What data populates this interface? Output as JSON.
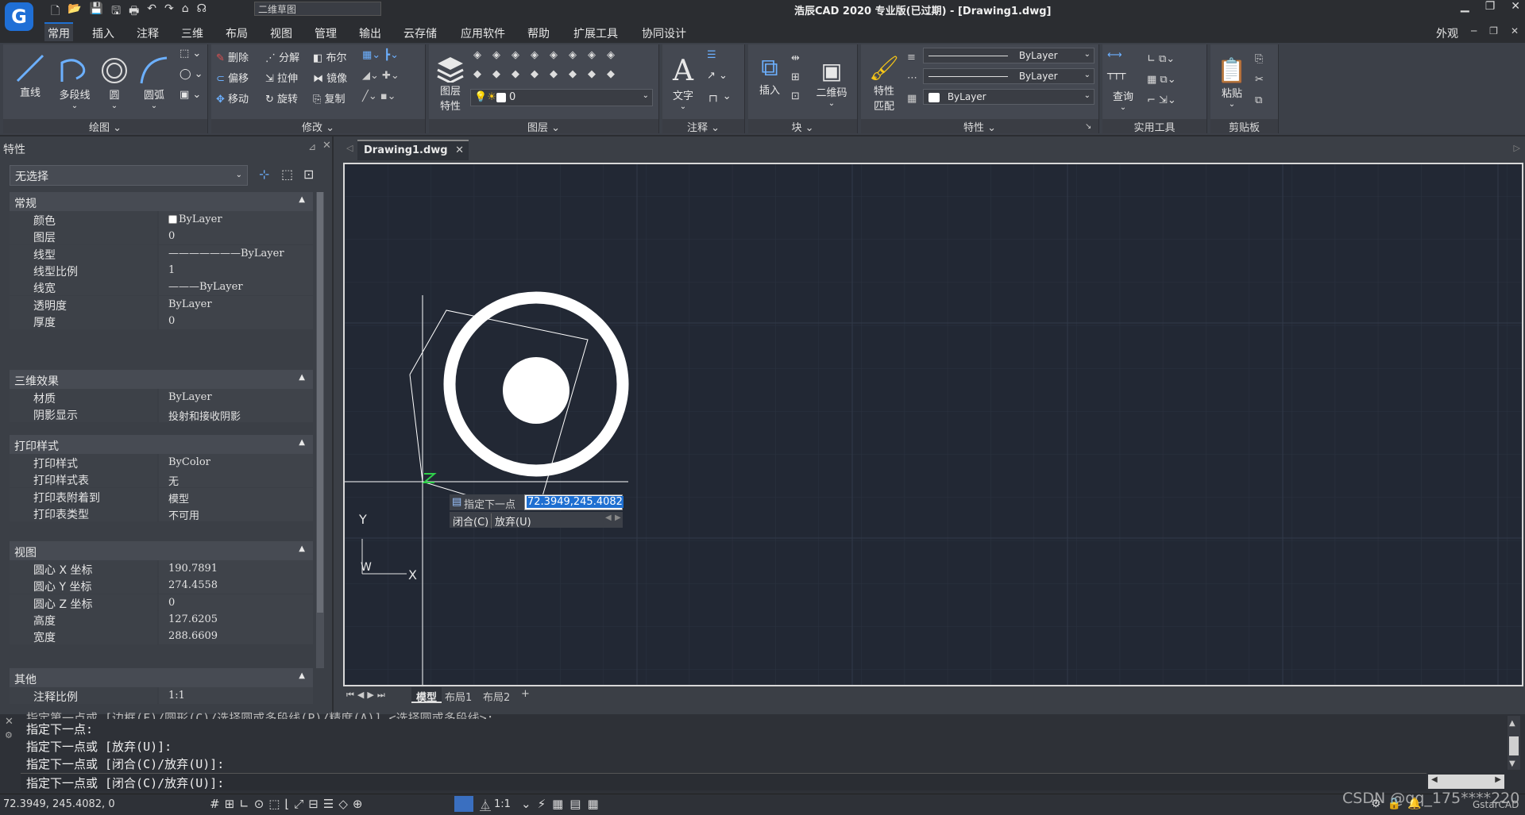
{
  "titlebar": {
    "title": "浩辰CAD 2020 专业版(已过期) - [Drawing1.dwg]",
    "workspace": "二维草图"
  },
  "menu": {
    "items": [
      "常用",
      "插入",
      "注释",
      "三维",
      "布局",
      "视图",
      "管理",
      "输出",
      "云存储",
      "应用软件",
      "帮助",
      "扩展工具",
      "协同设计"
    ],
    "right": "外观"
  },
  "ribbon": {
    "draw": {
      "label": "绘图",
      "line": "直线",
      "polyline": "多段线",
      "circle": "圆",
      "arc": "圆弧"
    },
    "modify": {
      "label": "修改",
      "erase": "删除",
      "explode": "分解",
      "boolean": "布尔",
      "offset": "偏移",
      "stretch": "拉伸",
      "mirror": "镜像",
      "move": "移动",
      "rotate": "旋转",
      "copy": "复制"
    },
    "layer": {
      "label": "图层",
      "props_l1": "图层",
      "props_l2": "特性",
      "current": "0"
    },
    "annotation": {
      "label": "注释",
      "text": "文字"
    },
    "block": {
      "label": "块",
      "insert": "插入",
      "qrcode": "二维码"
    },
    "properties": {
      "label": "特性",
      "match_l1": "特性",
      "match_l2": "匹配",
      "linetype": "ByLayer",
      "lineweight": "ByLayer",
      "color": "ByLayer"
    },
    "utilities": {
      "label": "实用工具",
      "query": "查询"
    },
    "clipboard": {
      "label": "剪贴板",
      "paste": "粘贴"
    }
  },
  "props_panel": {
    "title": "特性",
    "selection": "无选择",
    "groups": {
      "general": "常规",
      "3d": "三维效果",
      "plot": "打印样式",
      "view": "视图",
      "misc": "其他"
    },
    "general_rows": [
      {
        "k": "颜色",
        "v": "ByLayer"
      },
      {
        "k": "图层",
        "v": "0"
      },
      {
        "k": "线型",
        "v": "———————ByLayer"
      },
      {
        "k": "线型比例",
        "v": "1"
      },
      {
        "k": "线宽",
        "v": "———ByLayer"
      },
      {
        "k": "透明度",
        "v": "ByLayer"
      },
      {
        "k": "厚度",
        "v": "0"
      }
    ],
    "3d_rows": [
      {
        "k": "材质",
        "v": "ByLayer"
      },
      {
        "k": "阴影显示",
        "v": "投射和接收阴影"
      }
    ],
    "plot_rows": [
      {
        "k": "打印样式",
        "v": "ByColor"
      },
      {
        "k": "打印样式表",
        "v": "无"
      },
      {
        "k": "打印表附着到",
        "v": "模型"
      },
      {
        "k": "打印表类型",
        "v": "不可用"
      }
    ],
    "view_rows": [
      {
        "k": "圆心 X 坐标",
        "v": "190.7891"
      },
      {
        "k": "圆心 Y 坐标",
        "v": "274.4558"
      },
      {
        "k": "圆心 Z 坐标",
        "v": "0"
      },
      {
        "k": "高度",
        "v": "127.6205"
      },
      {
        "k": "宽度",
        "v": "288.6609"
      }
    ],
    "misc_rows": [
      {
        "k": "注释比例",
        "v": "1:1"
      }
    ]
  },
  "document": {
    "tab": "Drawing1.dwg"
  },
  "canvas": {
    "prompt": "指定下一点或",
    "input_value": "72.3949,245.4082",
    "opt_close": "闭合(C)",
    "opt_undo": "放弃(U)",
    "ucs_y": "Y",
    "ucs_x": "X",
    "ucs_w": "W"
  },
  "layouts": [
    "模型",
    "布局1",
    "布局2",
    "+"
  ],
  "command": {
    "lines": [
      "指定第一点或 [边框(F)/圆形(C)/选择圆或多段线(P)/精度(A)] <选择圆或多段线>:",
      "指定下一点:",
      "指定下一点或 [放弃(U)]:",
      "指定下一点或 [闭合(C)/放弃(U)]:",
      "指定下一点或 [闭合(C)/放弃(U)]:"
    ]
  },
  "status": {
    "coords": "72.3949, 245.4082, 0",
    "scale": "1:1",
    "watermark": "CSDN @qq_175****220",
    "brand": "GstarCAD"
  },
  "colors": {
    "accent_blue": "#1e6fd1",
    "canvas_bg": "#222834",
    "panel_bg": "#3b3f46"
  }
}
